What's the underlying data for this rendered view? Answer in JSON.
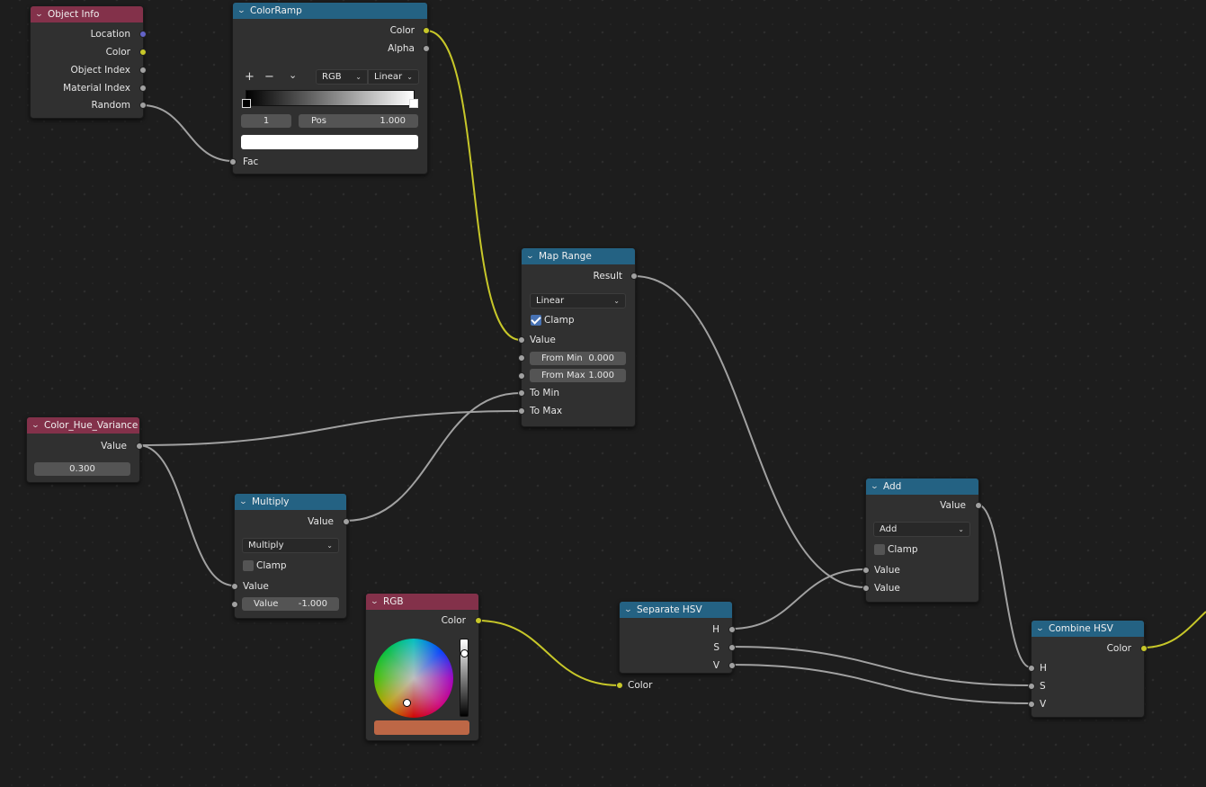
{
  "editor": "Shader Node Editor",
  "link_colors": {
    "float": "#a1a1a1",
    "color": "#c7c729",
    "vector": "#6363c7"
  },
  "header_colors": {
    "input": "#83314a",
    "converter": "#246283"
  },
  "nodes": {
    "object_info": {
      "title": "Object Info",
      "outputs": [
        "Location",
        "Color",
        "Object Index",
        "Material Index",
        "Random"
      ]
    },
    "color_ramp": {
      "title": "ColorRamp",
      "outputs": [
        "Color",
        "Alpha"
      ],
      "tools": {
        "add": "+",
        "remove": "−",
        "menu": "⌄"
      },
      "color_mode": "RGB",
      "interpolation": "Linear",
      "active_stop_index": "1",
      "pos_label": "Pos",
      "pos_value": "1.000",
      "stop_color": "#ffffff",
      "stops": [
        {
          "position": 0.0,
          "color": "#000000"
        },
        {
          "position": 1.0,
          "color": "#ffffff"
        }
      ],
      "input": "Fac"
    },
    "map_range": {
      "title": "Map Range",
      "output": "Result",
      "interpolation": "Linear",
      "clamp_label": "Clamp",
      "clamp": true,
      "inputs": {
        "value": "Value",
        "from_min_label": "From Min",
        "from_min": "0.000",
        "from_max_label": "From Max",
        "from_max": "1.000",
        "to_min": "To Min",
        "to_max": "To Max"
      }
    },
    "hue_variance": {
      "title": "Color_Hue_Variance",
      "output": "Value",
      "value": "0.300"
    },
    "multiply": {
      "title": "Multiply",
      "output": "Value",
      "operation": "Multiply",
      "clamp_label": "Clamp",
      "clamp": false,
      "input1": "Value",
      "input2_label": "Value",
      "input2_value": "-1.000"
    },
    "rgb": {
      "title": "RGB",
      "output": "Color",
      "color": "#bd6746",
      "value_slider": 0.85
    },
    "separate_hsv": {
      "title": "Separate HSV",
      "outputs": [
        "H",
        "S",
        "V"
      ],
      "input": "Color"
    },
    "add": {
      "title": "Add",
      "output": "Value",
      "operation": "Add",
      "clamp_label": "Clamp",
      "clamp": false,
      "inputs": [
        "Value",
        "Value"
      ]
    },
    "combine_hsv": {
      "title": "Combine HSV",
      "output": "Color",
      "inputs": [
        "H",
        "S",
        "V"
      ]
    }
  }
}
